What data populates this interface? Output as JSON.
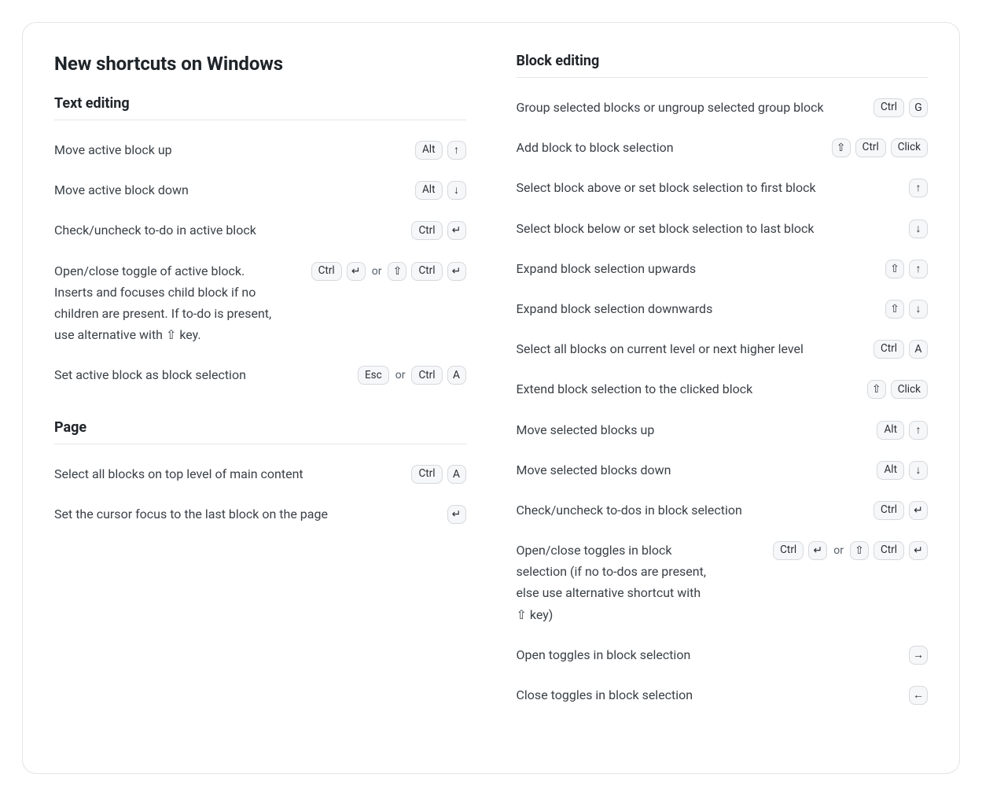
{
  "page_title": "New shortcuts on Windows",
  "or_label": "or",
  "keys": {
    "ctrl": "Ctrl",
    "alt": "Alt",
    "esc": "Esc",
    "click": "Click",
    "g": "G",
    "a": "A",
    "shift_icon": "⇧",
    "enter_icon": "↵",
    "up_icon": "↑",
    "down_icon": "↓",
    "right_icon": "→",
    "left_icon": "←"
  },
  "sections": {
    "text_editing": {
      "heading": "Text editing",
      "rows": {
        "move_up": {
          "desc": "Move active block up"
        },
        "move_down": {
          "desc": "Move active block down"
        },
        "todo": {
          "desc": "Check/uncheck to-do in active block"
        },
        "toggle": {
          "desc": "Open/close toggle of active block. Inserts and focuses child block if no children are present. If to-do is present, use alternative with ⇧ key."
        },
        "set_sel": {
          "desc": "Set active block as block selection"
        }
      }
    },
    "page": {
      "heading": "Page",
      "rows": {
        "select_all": {
          "desc": "Select all blocks on top level of main content"
        },
        "focus_last": {
          "desc": "Set the cursor focus to the last block on the page"
        }
      }
    },
    "block_editing": {
      "heading": "Block editing",
      "rows": {
        "group": {
          "desc": "Group selected blocks or ungroup selected group block"
        },
        "add_sel": {
          "desc": "Add block to block selection"
        },
        "sel_above": {
          "desc": "Select block above or set block selection to first block"
        },
        "sel_below": {
          "desc": "Select block below or set block selection to last block"
        },
        "expand_up": {
          "desc": "Expand block selection upwards"
        },
        "expand_down": {
          "desc": "Expand block selection downwards"
        },
        "select_all": {
          "desc": "Select all blocks on current level or next higher level"
        },
        "extend_click": {
          "desc": "Extend block selection to the clicked block"
        },
        "move_up": {
          "desc": "Move selected blocks up"
        },
        "move_down": {
          "desc": "Move selected blocks down"
        },
        "todo": {
          "desc": "Check/uncheck to-dos in block selection"
        },
        "toggle": {
          "desc": "Open/close toggles in block selection (if no to-dos are present, else use alternative shortcut with ⇧ key)"
        },
        "open_tog": {
          "desc": "Open toggles in block selection"
        },
        "close_tog": {
          "desc": "Close toggles in block selection"
        }
      }
    }
  }
}
